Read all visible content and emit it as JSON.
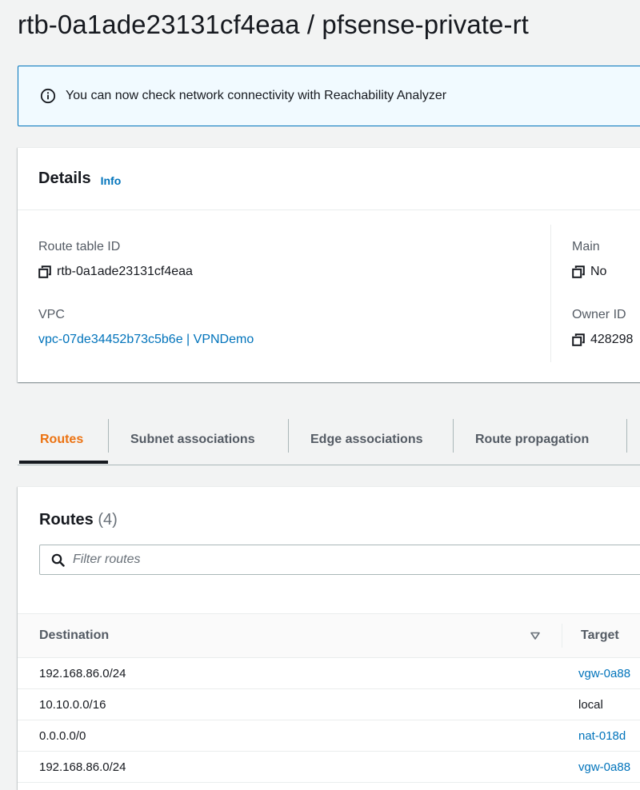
{
  "page": {
    "title": "rtb-0a1ade23131cf4eaa / pfsense-private-rt"
  },
  "banner": {
    "text": "You can now check network connectivity with Reachability Analyzer"
  },
  "details": {
    "title": "Details",
    "info_link": "Info",
    "route_table_id_label": "Route table ID",
    "route_table_id_value": "rtb-0a1ade23131cf4eaa",
    "vpc_label": "VPC",
    "vpc_value": "vpc-07de34452b73c5b6e | VPNDemo",
    "main_label": "Main",
    "main_value": "No",
    "owner_id_label": "Owner ID",
    "owner_id_value": "428298"
  },
  "tabs": [
    {
      "label": "Routes",
      "active": true
    },
    {
      "label": "Subnet associations",
      "active": false
    },
    {
      "label": "Edge associations",
      "active": false
    },
    {
      "label": "Route propagation",
      "active": false
    }
  ],
  "routes": {
    "title": "Routes",
    "count": "(4)",
    "filter_placeholder": "Filter routes",
    "columns": {
      "destination": "Destination",
      "target": "Target"
    },
    "rows": [
      {
        "destination": "192.168.86.0/24",
        "target": "vgw-0a88",
        "target_is_link": true
      },
      {
        "destination": "10.10.0.0/16",
        "target": "local",
        "target_is_link": false
      },
      {
        "destination": "0.0.0.0/0",
        "target": "nat-018d",
        "target_is_link": true
      },
      {
        "destination": "192.168.86.0/24",
        "target": "vgw-0a88",
        "target_is_link": true
      }
    ]
  },
  "colors": {
    "accent_orange": "#ec7211",
    "link_blue": "#0073bb",
    "banner_bg": "#f1faff"
  },
  "icons": {
    "banner": "info-circle-icon",
    "copy": "copy-icon",
    "search": "search-icon",
    "sort": "sort-down-icon"
  }
}
